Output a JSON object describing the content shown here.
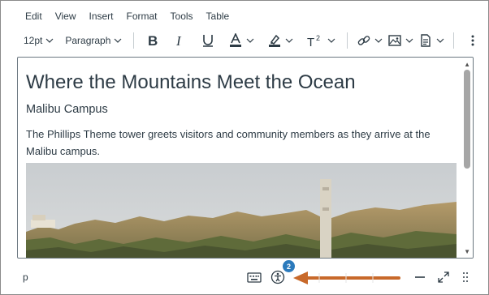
{
  "menubar": {
    "items": [
      "Edit",
      "View",
      "Insert",
      "Format",
      "Tools",
      "Table"
    ]
  },
  "toolbar": {
    "font_size": "12pt",
    "block_format": "Paragraph",
    "icons": [
      "bold-icon",
      "italic-icon",
      "underline-icon",
      "text-color-icon",
      "highlight-color-icon",
      "superscript-icon",
      "link-icon",
      "image-icon",
      "document-icon",
      "more-icon"
    ]
  },
  "content": {
    "heading": "Where the Mountains Meet the Ocean",
    "subheading": "Malibu Campus",
    "paragraph": "The Phillips Theme tower greets visitors and community members as they arrive at the Malibu campus."
  },
  "statusbar": {
    "path": "p",
    "accessibility_badge": "2"
  },
  "colors": {
    "badge": "#2b7abc",
    "arrow": "#c8692a",
    "text": "#2d3b45"
  }
}
